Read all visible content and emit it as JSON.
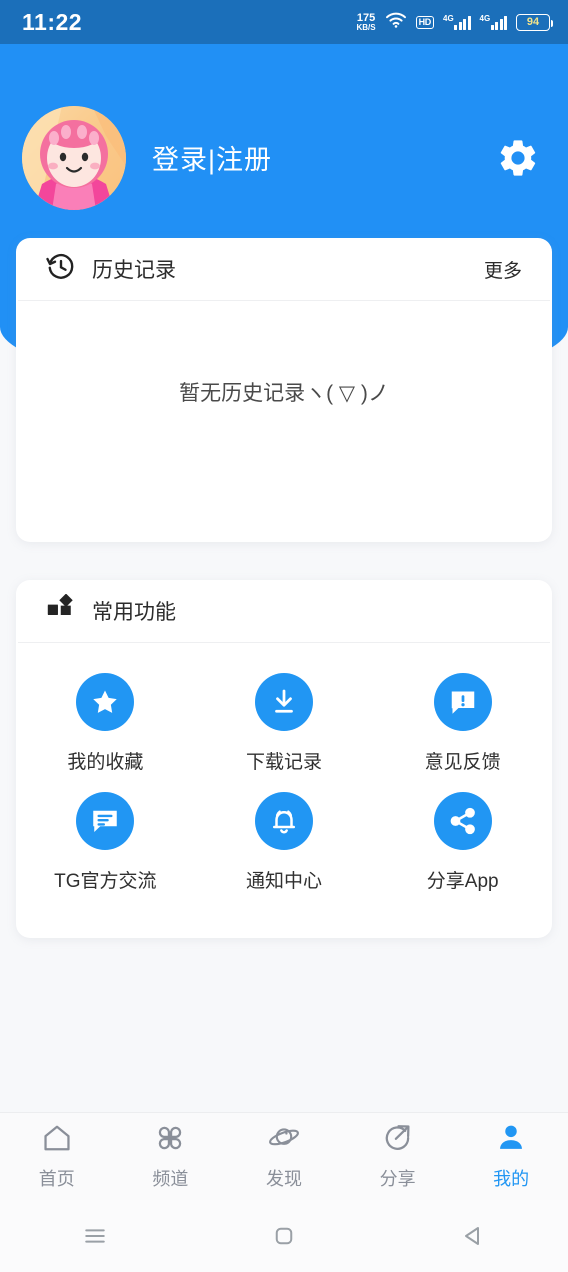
{
  "statusbar": {
    "time": "11:22",
    "net_speed_value": "175",
    "net_speed_unit": "KB/S",
    "hd_label": "HD",
    "sim1_label": "4G",
    "sim2_label": "4G",
    "battery_level": "94"
  },
  "header": {
    "login_text": "登录|注册",
    "settings_icon": "gear-icon",
    "avatar_icon": "avatar",
    "bg_color": "#2190F5"
  },
  "history": {
    "icon": "history-clock-icon",
    "title": "历史记录",
    "more_label": "更多",
    "empty_text": "暂无历史记录ヽ( ▽ )ノ"
  },
  "functions": {
    "icon": "grid-shapes-icon",
    "title": "常用功能",
    "accent_color": "#2196F3",
    "items": [
      {
        "label": "我的收藏",
        "icon": "star-icon"
      },
      {
        "label": "下载记录",
        "icon": "download-icon"
      },
      {
        "label": "意见反馈",
        "icon": "feedback-icon"
      },
      {
        "label": "TG官方交流",
        "icon": "chat-icon"
      },
      {
        "label": "通知中心",
        "icon": "bell-icon"
      },
      {
        "label": "分享App",
        "icon": "share-icon"
      }
    ]
  },
  "bottomnav": {
    "active_color": "#2196F3",
    "inactive_color": "#8A8F99",
    "items": [
      {
        "label": "首页",
        "icon": "home-icon",
        "active": false
      },
      {
        "label": "频道",
        "icon": "clover-icon",
        "active": false
      },
      {
        "label": "发现",
        "icon": "planet-icon",
        "active": false
      },
      {
        "label": "分享",
        "icon": "share-arrow-icon",
        "active": false
      },
      {
        "label": "我的",
        "icon": "person-icon",
        "active": true
      }
    ]
  },
  "sysnav": {
    "items": [
      {
        "icon": "menu-recents-icon"
      },
      {
        "icon": "home-square-icon"
      },
      {
        "icon": "back-triangle-icon"
      }
    ]
  }
}
